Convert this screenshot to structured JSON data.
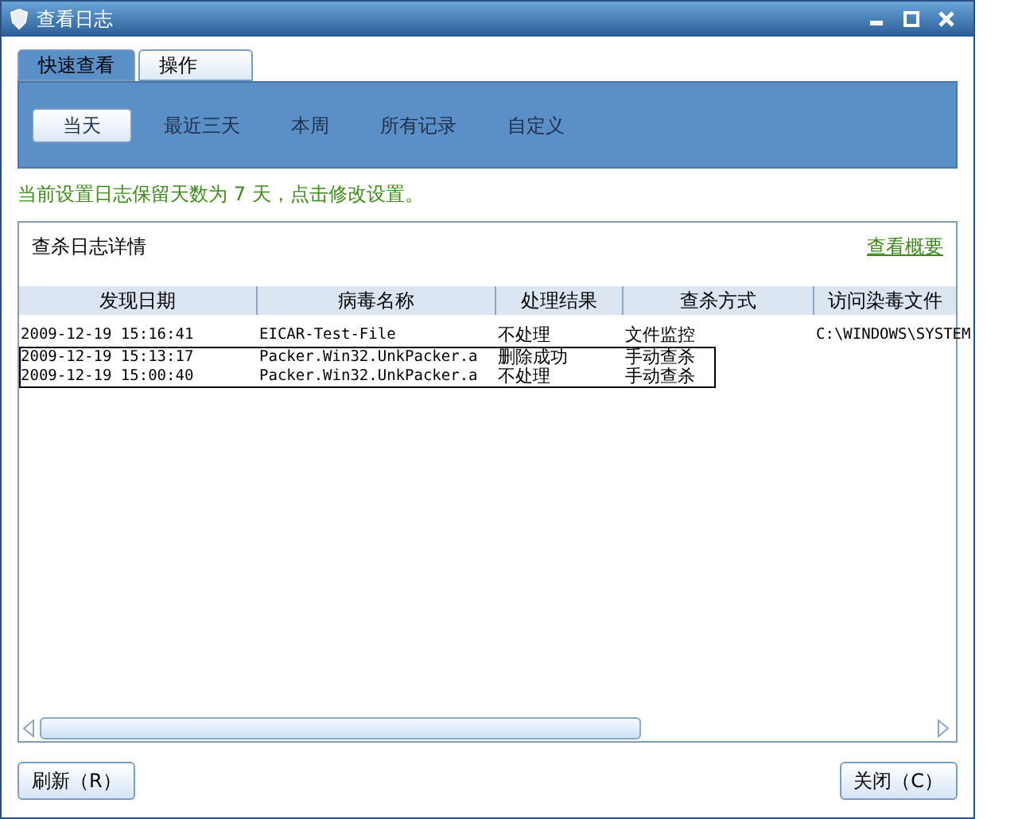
{
  "window": {
    "title": "查看日志"
  },
  "tabs": [
    {
      "label": "快速查看",
      "selected": true
    },
    {
      "label": "操作",
      "selected": false
    }
  ],
  "ranges": [
    {
      "label": "当天",
      "selected": true
    },
    {
      "label": "最近三天",
      "selected": false
    },
    {
      "label": "本周",
      "selected": false
    },
    {
      "label": "所有记录",
      "selected": false
    },
    {
      "label": "自定义",
      "selected": false
    }
  ],
  "notice": "当前设置日志保留天数为 7 天，点击修改设置。",
  "log": {
    "title": "查杀日志详情",
    "summary_link": "查看概要",
    "columns": [
      "发现日期",
      "病毒名称",
      "处理结果",
      "查杀方式",
      "访问染毒文件"
    ],
    "rows": [
      {
        "cells": [
          "2009-12-19 15:16:41",
          "EICAR-Test-File",
          "不处理",
          "文件监控",
          "C:\\WINDOWS\\SYSTEM"
        ],
        "selected": false
      },
      {
        "cells": [
          "2009-12-19 15:13:17",
          "Packer.Win32.UnkPacker.a",
          "删除成功",
          "手动查杀"
        ],
        "selected": true
      },
      {
        "cells": [
          "2009-12-19 15:00:40",
          "Packer.Win32.UnkPacker.a",
          "不处理",
          "手动查杀"
        ],
        "selected": true
      }
    ]
  },
  "buttons": [
    {
      "label": "刷新（R）"
    },
    {
      "label": "关闭（C）"
    }
  ]
}
